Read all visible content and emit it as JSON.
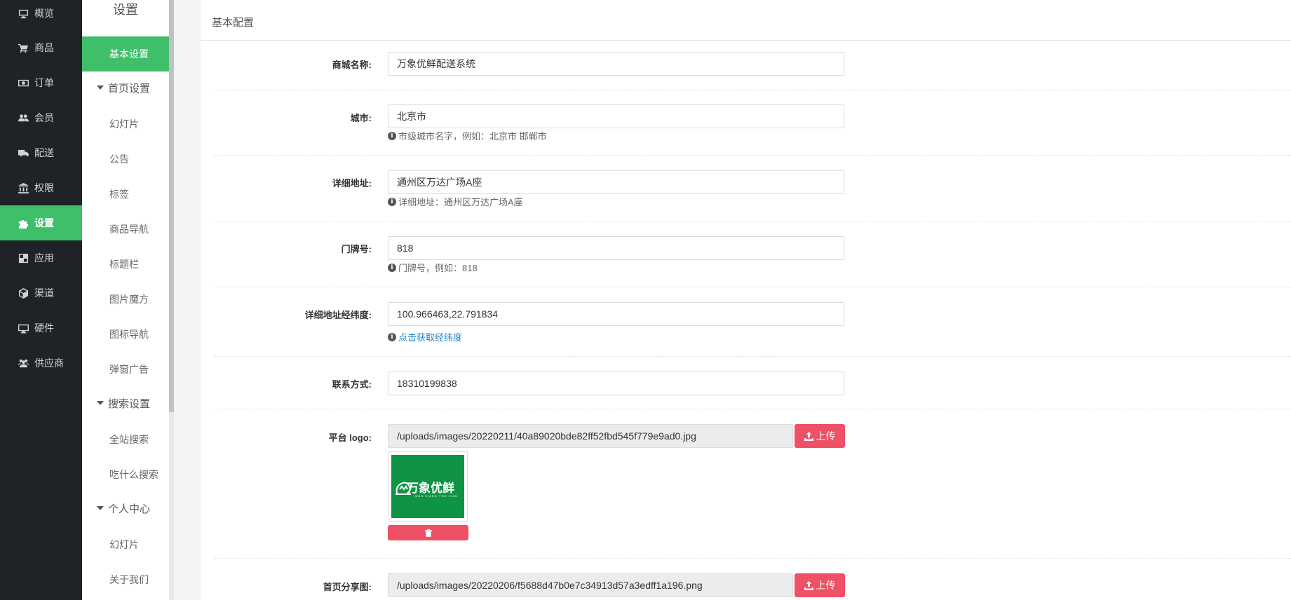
{
  "nav": {
    "items": [
      {
        "label": "概览",
        "icon": "monitor-icon"
      },
      {
        "label": "商品",
        "icon": "cart-icon"
      },
      {
        "label": "订单",
        "icon": "money-icon"
      },
      {
        "label": "会员",
        "icon": "users-icon"
      },
      {
        "label": "配送",
        "icon": "truck-icon"
      },
      {
        "label": "权限",
        "icon": "bank-icon"
      },
      {
        "label": "设置",
        "icon": "puzzle-icon"
      },
      {
        "label": "应用",
        "icon": "grid-icon"
      },
      {
        "label": "渠道",
        "icon": "cube-icon"
      },
      {
        "label": "硬件",
        "icon": "desktop-icon"
      },
      {
        "label": "供应商",
        "icon": "supplier-icon"
      }
    ],
    "active": "设置"
  },
  "submenu": {
    "title": "设置",
    "basic": "基本设置",
    "group_home": "首页设置",
    "home_items": [
      "幻灯片",
      "公告",
      "标签",
      "商品导航",
      "标题栏",
      "图片魔方",
      "图标导航",
      "弹窗广告"
    ],
    "group_search": "搜索设置",
    "search_items": [
      "全站搜索",
      "吃什么搜索"
    ],
    "group_personal": "个人中心",
    "personal_items": [
      "幻灯片",
      "关于我们"
    ]
  },
  "panel": {
    "title": "基本配置",
    "fields": {
      "shop_name": {
        "label": "商城名称:",
        "value": "万象优鲜配送系统"
      },
      "city": {
        "label": "城市:",
        "value": "北京市",
        "help": "市级城市名字，例如：北京市 邯郸市"
      },
      "address": {
        "label": "详细地址:",
        "value": "通州区万达广场A座",
        "help": "详细地址：通州区万达广场A座"
      },
      "door_no": {
        "label": "门牌号:",
        "value": "818",
        "help": "门牌号，例如：818"
      },
      "coords": {
        "label": "详细地址经纬度:",
        "value": "100.966463,22.791834",
        "help_link": "点击获取经纬度"
      },
      "contact": {
        "label": "联系方式:",
        "value": "18310199838"
      },
      "logo": {
        "label": "平台 logo:",
        "value": "/uploads/images/20220211/40a89020bde82ff52fbd545f779e9ad0.jpg",
        "upload": "上传",
        "logo_text": "万象优鲜",
        "logo_sub": "WAN XIANG YOU XIAN"
      },
      "share": {
        "label": "首页分享图:",
        "value": "/uploads/images/20220206/f5688d47b0e7c34913d57a3edff1a196.png",
        "upload": "上传"
      }
    }
  },
  "colors": {
    "accent": "#3fbf6a",
    "sidebar": "#1f2327",
    "danger": "#ee5065",
    "link": "#1c7ec2"
  }
}
